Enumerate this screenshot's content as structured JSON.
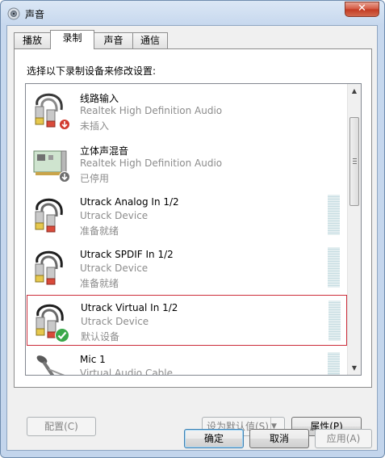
{
  "window": {
    "title": "声音",
    "close_label": "✕"
  },
  "tabs": [
    {
      "label": "播放",
      "active": false
    },
    {
      "label": "录制",
      "active": true
    },
    {
      "label": "声音",
      "active": false
    },
    {
      "label": "通信",
      "active": false
    }
  ],
  "panel": {
    "prompt": "选择以下录制设备来修改设置:"
  },
  "devices": [
    {
      "name": "线路输入",
      "driver": "Realtek High Definition Audio",
      "status": "未插入",
      "icon": "rca-cable-icon",
      "badge": "red-down-arrow-badge",
      "selected": false,
      "level_meter": false
    },
    {
      "name": "立体声混音",
      "driver": "Realtek High Definition Audio",
      "status": "已停用",
      "icon": "sound-card-icon",
      "badge": "gray-down-arrow-badge",
      "selected": false,
      "level_meter": false
    },
    {
      "name": "Utrack Analog In 1/2",
      "driver": "Utrack Device",
      "status": "准备就绪",
      "icon": "rca-cable-icon",
      "badge": "",
      "selected": false,
      "level_meter": true
    },
    {
      "name": "Utrack SPDIF In 1/2",
      "driver": "Utrack Device",
      "status": "准备就绪",
      "icon": "rca-cable-icon",
      "badge": "",
      "selected": false,
      "level_meter": true
    },
    {
      "name": "Utrack Virtual In 1/2",
      "driver": "Utrack Device",
      "status": "默认设备",
      "icon": "rca-cable-icon",
      "badge": "green-check-badge",
      "selected": true,
      "level_meter": true
    },
    {
      "name": "Mic 1",
      "driver": "Virtual Audio Cable",
      "status": "",
      "icon": "microphone-icon",
      "badge": "",
      "selected": false,
      "level_meter": true
    }
  ],
  "buttons": {
    "configure": "配置(C)",
    "set_default": "设为默认值(S)",
    "properties": "属性(P)",
    "ok": "确定",
    "cancel": "取消",
    "apply": "应用(A)"
  }
}
